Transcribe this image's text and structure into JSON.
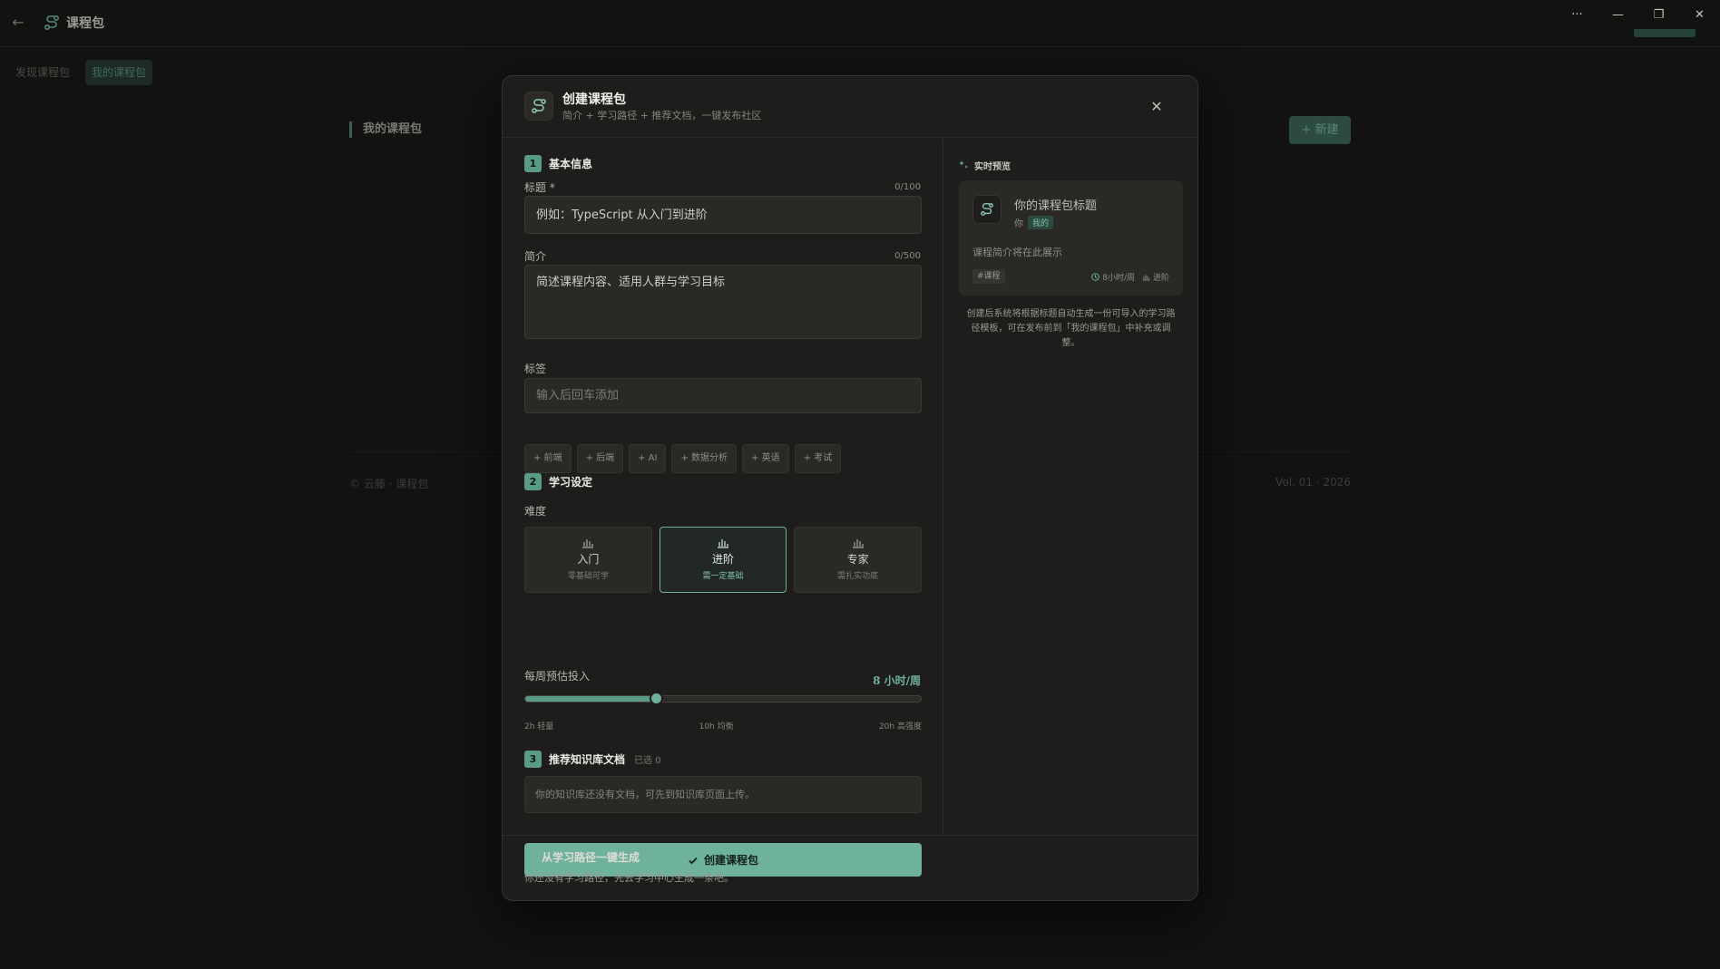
{
  "app": {
    "title": "课程包",
    "tabs": [
      {
        "label": "发现课程包",
        "active": false
      },
      {
        "label": "我的课程包",
        "active": true
      }
    ],
    "section_title": "我的课程包",
    "new_button": "+ 新建",
    "footer_left": "© 云藤 · 课程包",
    "footer_right": "Vol. 01 · 2026",
    "window_controls": [
      "···",
      "—",
      "❐",
      "✕"
    ]
  },
  "modal": {
    "title": "创建课程包",
    "subtitle": "简介 + 学习路径 + 推荐文档，一键发布社区",
    "close_icon": "close-icon",
    "step1": {
      "num": "1",
      "label": "基本信息",
      "title_label": "标题 *",
      "title_count": "0/100",
      "title_placeholder": "例如：TypeScript 从入门到进阶",
      "intro_label": "简介",
      "intro_count": "0/500",
      "intro_placeholder": "简述课程内容、适用人群与学习目标",
      "tags_label": "标签",
      "tags_placeholder": "输入后回车添加",
      "tag_suggestions": [
        "+ 前端",
        "+ 后端",
        "+ AI",
        "+ 数据分析",
        "+ 英语",
        "+ 考试"
      ]
    },
    "step2": {
      "num": "2",
      "label": "学习设定",
      "difficulty_label": "难度",
      "levels": [
        {
          "name": "入门",
          "desc": "零基础可学",
          "selected": false
        },
        {
          "name": "进阶",
          "desc": "需一定基础",
          "selected": true
        },
        {
          "name": "专家",
          "desc": "需扎实功底",
          "selected": false
        }
      ],
      "hours_label": "每周预估投入",
      "hours_value": "8 小时/周",
      "hours": 8,
      "hours_min": 2,
      "hours_max": 20,
      "ticks": [
        "2h 轻量",
        "10h 均衡",
        "20h 高强度"
      ]
    },
    "step3": {
      "num": "3",
      "label": "推荐知识库文档",
      "selected_count": "已选 0",
      "empty_text": "你的知识库还没有文档，可先到知识库页面上传。"
    },
    "create_button": "创建课程包",
    "preview": {
      "header": "实时预览",
      "title": "你的课程包标题",
      "author": "你",
      "badge": "我的",
      "desc": "课程简介将在此展示",
      "tag": "#课程",
      "hours": "8小时/周",
      "level": "进阶",
      "note": "创建后系统将根据标题自动生成一份可导入的学习路径模板，可在发布前到「我的课程包」中补充或调整。"
    },
    "from_path": {
      "title": "从学习路径一键生成",
      "desc": "你还没有学习路径，先去学习中心生成一条吧。"
    }
  },
  "colors": {
    "accent": "#6fb29b",
    "background": "#121211",
    "modal_bg": "#1e1d1b"
  }
}
